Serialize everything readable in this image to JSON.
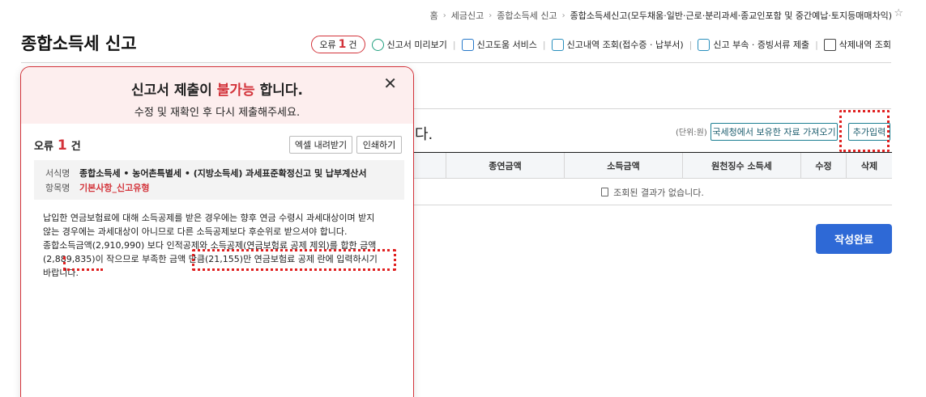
{
  "breadcrumb": [
    "홈",
    "세금신고",
    "종합소득세 신고",
    "종합소득세신고(모두채움·일반·근로·분리과세·종교인포함 및 중간예납·토지등매매차익)"
  ],
  "page_title": "종합소득세 신고",
  "toolbar": {
    "error_label": "오류",
    "error_count": "1",
    "error_unit": "건",
    "items": [
      {
        "label": "신고서 미리보기",
        "icon": "magnifier-icon"
      },
      {
        "label": "신고도움 서비스",
        "icon": "monitor-icon"
      },
      {
        "label": "신고내역 조회(접수증 · 납부서)",
        "icon": "document-icon"
      },
      {
        "label": "신고 부속 · 증빙서류 제출",
        "icon": "upload-document-icon"
      },
      {
        "label": "삭제내역 조회",
        "icon": "basket-icon"
      }
    ]
  },
  "section": {
    "title_tail": "다.",
    "unit_label": "(단위:원)",
    "fetch_button": "국세청에서 보유한 자료 가져오기",
    "add_button": "추가입력",
    "columns": [
      "종연금액",
      "소득금액",
      "원천징수 소득세",
      "수정",
      "삭제"
    ],
    "empty_message": "조회된 결과가 없습니다.",
    "complete_button": "작성완료"
  },
  "modal": {
    "title_prefix": "신고서 제출이",
    "title_highlight": "불가능",
    "title_suffix": "합니다.",
    "subtitle": "수정 및 재확인 후 다시 제출해주세요.",
    "error_label": "오류",
    "error_count": "1",
    "error_unit": "건",
    "excel_button": "엑셀 내려받기",
    "print_button": "인쇄하기",
    "form_key": "서식명",
    "form_value": "종합소득세 • 농어촌특별세 • (지방소득세) 과세표준확정신고 및 납부계산서",
    "item_key": "항목명",
    "item_value": "기본사항_신고유형",
    "message_lines": [
      "납입한 연금보험료에 대해 소득공제를 받은 경우에는 향후 연금 수령시 과세대상이며 받지",
      "않는 경우에는 과세대상이 아니므로 다른 소득공제보다 후순위로 받으셔야 합니다.",
      "종합소득금액(2,910,990) 보다 인적공제와 소득공제(연금보험료 공제 제외)를 합한 금액",
      "(2,889,835)이 작으므로 부족한 금액 만큼(21,155)만 연금보험료 공제 란에 입력하시기",
      "바랍니다."
    ]
  },
  "colors": {
    "accent_red": "#d3333a",
    "primary_blue": "#2e69d6",
    "teal_border": "#1c7f93",
    "annotation_red": "#e02020"
  }
}
